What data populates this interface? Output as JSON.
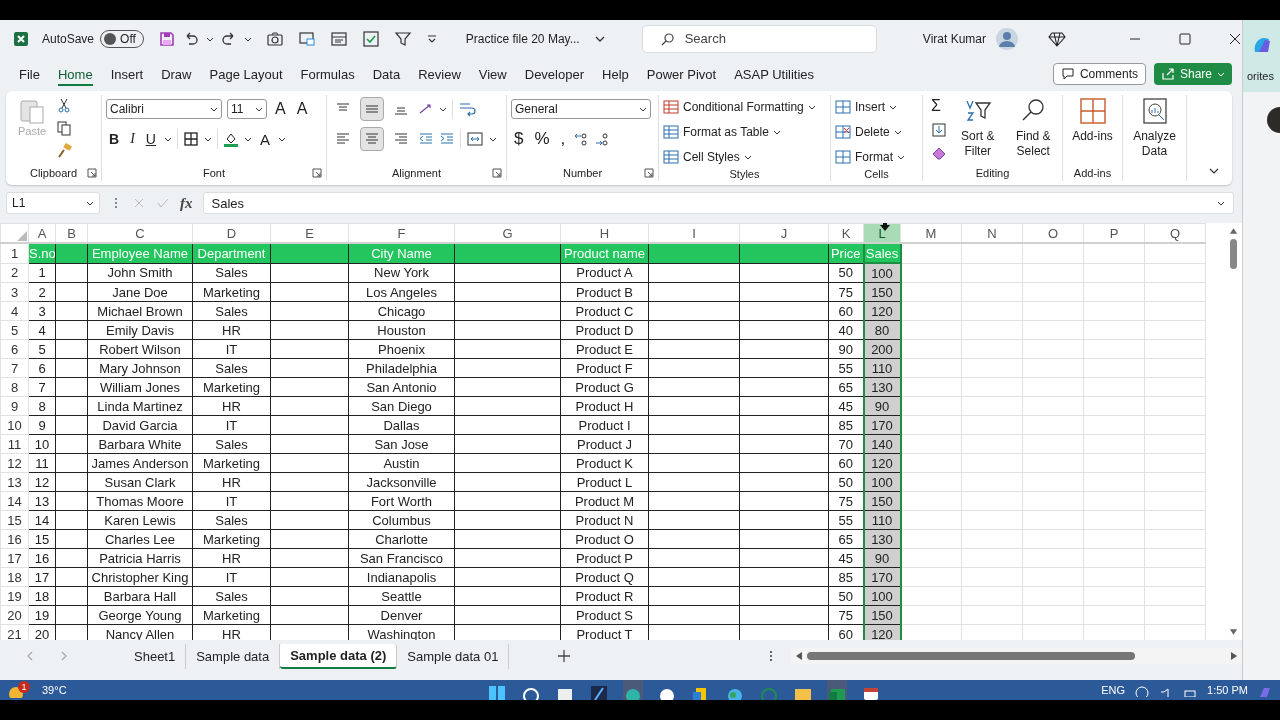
{
  "title_bar": {
    "autosave_label": "AutoSave",
    "autosave": {
      "text": "Off",
      "on": false
    },
    "file_name": "Practice file 20 May...",
    "search_placeholder": "Search",
    "user_name": "Virat Kumar"
  },
  "menu_tabs": [
    {
      "label": "File",
      "selected": false
    },
    {
      "label": "Home",
      "selected": true
    },
    {
      "label": "Insert",
      "selected": false
    },
    {
      "label": "Draw",
      "selected": false
    },
    {
      "label": "Page Layout",
      "selected": false
    },
    {
      "label": "Formulas",
      "selected": false
    },
    {
      "label": "Data",
      "selected": false
    },
    {
      "label": "Review",
      "selected": false
    },
    {
      "label": "View",
      "selected": false
    },
    {
      "label": "Developer",
      "selected": false
    },
    {
      "label": "Help",
      "selected": false
    },
    {
      "label": "Power Pivot",
      "selected": false
    },
    {
      "label": "ASAP Utilities",
      "selected": false
    }
  ],
  "comments_button": "Comments",
  "share_button": "Share",
  "ribbon": {
    "clipboard": {
      "label": "Clipboard",
      "paste": {
        "text": "Paste",
        "disabled": true
      }
    },
    "font": {
      "label": "Font",
      "font_name": "Calibri",
      "font_size": "11",
      "size_buttons": [
        "A",
        "A"
      ],
      "style_buttons": [
        "B",
        "I",
        "U"
      ],
      "font_color_button": "A"
    },
    "alignment": {
      "label": "Alignment",
      "vertical": [
        {
          "selected": false
        },
        {
          "selected": true
        },
        {
          "selected": false
        }
      ],
      "horizontal": [
        {
          "selected": false
        },
        {
          "selected": true
        },
        {
          "selected": false
        }
      ]
    },
    "number": {
      "label": "Number",
      "format": "General",
      "symbols": [
        "$",
        "%",
        ","
      ]
    },
    "styles": {
      "label": "Styles",
      "buttons": [
        "Conditional Formatting",
        "Format as Table",
        "Cell Styles"
      ]
    },
    "cells": {
      "label": "Cells",
      "buttons": [
        "Insert",
        "Delete",
        "Format"
      ]
    },
    "editing": {
      "label": "Editing",
      "sum": "Σ",
      "buttons": [
        "Sort & Filter",
        "Find & Select"
      ]
    },
    "addins": {
      "label": "Add-ins",
      "button": "Add-ins"
    },
    "analyze": {
      "button": "Analyze Data"
    }
  },
  "formula_bar": {
    "name_box": "L1",
    "function_label": "fx",
    "formula": "Sales"
  },
  "table": {
    "columns": [
      {
        "letter": "A",
        "selected": false
      },
      {
        "letter": "B",
        "selected": false
      },
      {
        "letter": "C",
        "selected": false
      },
      {
        "letter": "D",
        "selected": false
      },
      {
        "letter": "E",
        "selected": false
      },
      {
        "letter": "F",
        "selected": false
      },
      {
        "letter": "G",
        "selected": false
      },
      {
        "letter": "H",
        "selected": false
      },
      {
        "letter": "I",
        "selected": false
      },
      {
        "letter": "J",
        "selected": false
      },
      {
        "letter": "K",
        "selected": false
      },
      {
        "letter": "L",
        "selected": true
      },
      {
        "letter": "M",
        "selected": false
      },
      {
        "letter": "N",
        "selected": false
      },
      {
        "letter": "O",
        "selected": false
      },
      {
        "letter": "P",
        "selected": false
      },
      {
        "letter": "Q",
        "selected": false
      }
    ],
    "header_row": {
      "row_number": "1",
      "A": "S.no",
      "C": "Employee Name",
      "D": "Department",
      "F": "City Name",
      "H": "Product name",
      "K": "Price",
      "L": "Sales"
    },
    "rows": [
      {
        "row_number": "2",
        "A": "1",
        "C": "John Smith",
        "D": "Sales",
        "F": "New York",
        "H": "Product A",
        "K": "50",
        "L": "100"
      },
      {
        "row_number": "3",
        "A": "2",
        "C": "Jane Doe",
        "D": "Marketing",
        "F": "Los Angeles",
        "H": "Product B",
        "K": "75",
        "L": "150"
      },
      {
        "row_number": "4",
        "A": "3",
        "C": "Michael Brown",
        "D": "Sales",
        "F": "Chicago",
        "H": "Product C",
        "K": "60",
        "L": "120"
      },
      {
        "row_number": "5",
        "A": "4",
        "C": "Emily Davis",
        "D": "HR",
        "F": "Houston",
        "H": "Product D",
        "K": "40",
        "L": "80"
      },
      {
        "row_number": "6",
        "A": "5",
        "C": "Robert Wilson",
        "D": "IT",
        "F": "Phoenix",
        "H": "Product E",
        "K": "90",
        "L": "200"
      },
      {
        "row_number": "7",
        "A": "6",
        "C": "Mary Johnson",
        "D": "Sales",
        "F": "Philadelphia",
        "H": "Product F",
        "K": "55",
        "L": "110"
      },
      {
        "row_number": "8",
        "A": "7",
        "C": "William Jones",
        "D": "Marketing",
        "F": "San Antonio",
        "H": "Product G",
        "K": "65",
        "L": "130"
      },
      {
        "row_number": "9",
        "A": "8",
        "C": "Linda Martinez",
        "D": "HR",
        "F": "San Diego",
        "H": "Product H",
        "K": "45",
        "L": "90"
      },
      {
        "row_number": "10",
        "A": "9",
        "C": "David Garcia",
        "D": "IT",
        "F": "Dallas",
        "H": "Product I",
        "K": "85",
        "L": "170"
      },
      {
        "row_number": "11",
        "A": "10",
        "C": "Barbara White",
        "D": "Sales",
        "F": "San Jose",
        "H": "Product J",
        "K": "70",
        "L": "140"
      },
      {
        "row_number": "12",
        "A": "11",
        "C": "James Anderson",
        "D": "Marketing",
        "F": "Austin",
        "H": "Product K",
        "K": "60",
        "L": "120"
      },
      {
        "row_number": "13",
        "A": "12",
        "C": "Susan Clark",
        "D": "HR",
        "F": "Jacksonville",
        "H": "Product L",
        "K": "50",
        "L": "100"
      },
      {
        "row_number": "14",
        "A": "13",
        "C": "Thomas Moore",
        "D": "IT",
        "F": "Fort Worth",
        "H": "Product M",
        "K": "75",
        "L": "150"
      },
      {
        "row_number": "15",
        "A": "14",
        "C": "Karen Lewis",
        "D": "Sales",
        "F": "Columbus",
        "H": "Product N",
        "K": "55",
        "L": "110"
      },
      {
        "row_number": "16",
        "A": "15",
        "C": "Charles Lee",
        "D": "Marketing",
        "F": "Charlotte",
        "H": "Product O",
        "K": "65",
        "L": "130"
      },
      {
        "row_number": "17",
        "A": "16",
        "C": "Patricia Harris",
        "D": "HR",
        "F": "San Francisco",
        "H": "Product P",
        "K": "45",
        "L": "90"
      },
      {
        "row_number": "18",
        "A": "17",
        "C": "Christopher King",
        "D": "IT",
        "F": "Indianapolis",
        "H": "Product Q",
        "K": "85",
        "L": "170"
      },
      {
        "row_number": "19",
        "A": "18",
        "C": "Barbara Hall",
        "D": "Sales",
        "F": "Seattle",
        "H": "Product R",
        "K": "50",
        "L": "100"
      },
      {
        "row_number": "20",
        "A": "19",
        "C": "George Young",
        "D": "Marketing",
        "F": "Denver",
        "H": "Product S",
        "K": "75",
        "L": "150"
      },
      {
        "row_number": "21",
        "A": "20",
        "C": "Nancy Allen",
        "D": "HR",
        "F": "Washington",
        "H": "Product T",
        "K": "60",
        "L": "120"
      }
    ]
  },
  "sheet_tabs": [
    {
      "label": "Sheet1",
      "selected": false
    },
    {
      "label": "Sample data",
      "selected": false
    },
    {
      "label": "Sample data (2)",
      "selected": true
    },
    {
      "label": "Sample data 01",
      "selected": false
    }
  ],
  "side_app": {
    "text": "orites"
  },
  "taskbar": {
    "weather_badge": "1",
    "temperature": "39°C",
    "language": "ENG",
    "time": "1:50 PM"
  }
}
